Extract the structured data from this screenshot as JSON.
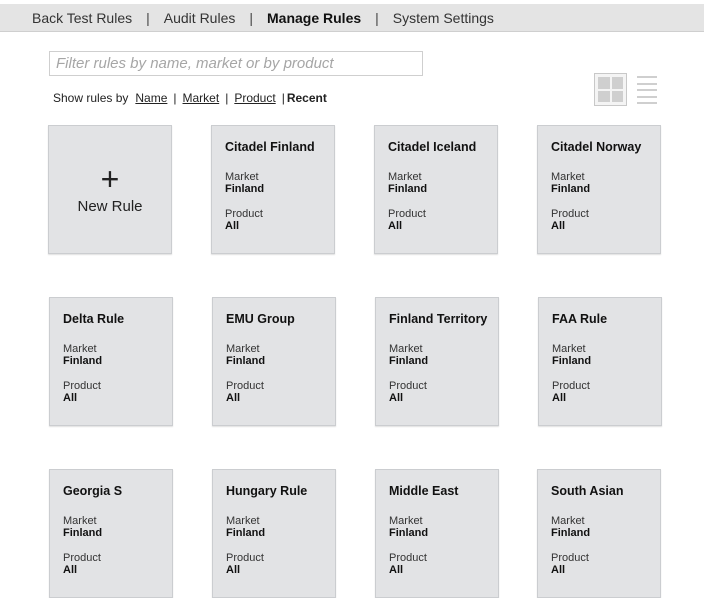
{
  "nav": {
    "items": [
      "Back Test Rules",
      "Audit Rules",
      "Manage Rules",
      "System Settings"
    ],
    "active": "Manage Rules"
  },
  "filter": {
    "placeholder": "Filter rules by name, market or by product",
    "value": ""
  },
  "show_by": {
    "label": "Show rules by",
    "options": [
      "Name",
      "Market",
      "Product"
    ],
    "current": "Recent"
  },
  "view_icons": [
    "grid-view-icon",
    "list-view-icon"
  ],
  "new_rule": {
    "plus": "+",
    "label": "New Rule"
  },
  "field_labels": {
    "market": "Market",
    "product": "Product"
  },
  "rules": [
    {
      "name": "Citadel Finland",
      "market": "Finland",
      "product": "All"
    },
    {
      "name": "Citadel Iceland",
      "market": "Finland",
      "product": "All"
    },
    {
      "name": "Citadel Norway",
      "market": "Finland",
      "product": "All"
    },
    {
      "name": "Delta Rule",
      "market": "Finland",
      "product": "All"
    },
    {
      "name": "EMU Group",
      "market": "Finland",
      "product": "All"
    },
    {
      "name": "Finland Territory",
      "market": "Finland",
      "product": "All"
    },
    {
      "name": "FAA Rule",
      "market": "Finland",
      "product": "All"
    },
    {
      "name": "Georgia S",
      "market": "Finland",
      "product": "All"
    },
    {
      "name": "Hungary Rule",
      "market": "Finland",
      "product": "All"
    },
    {
      "name": "Middle East",
      "market": "Finland",
      "product": "All"
    },
    {
      "name": "South Asian",
      "market": "Finland",
      "product": "All"
    }
  ]
}
